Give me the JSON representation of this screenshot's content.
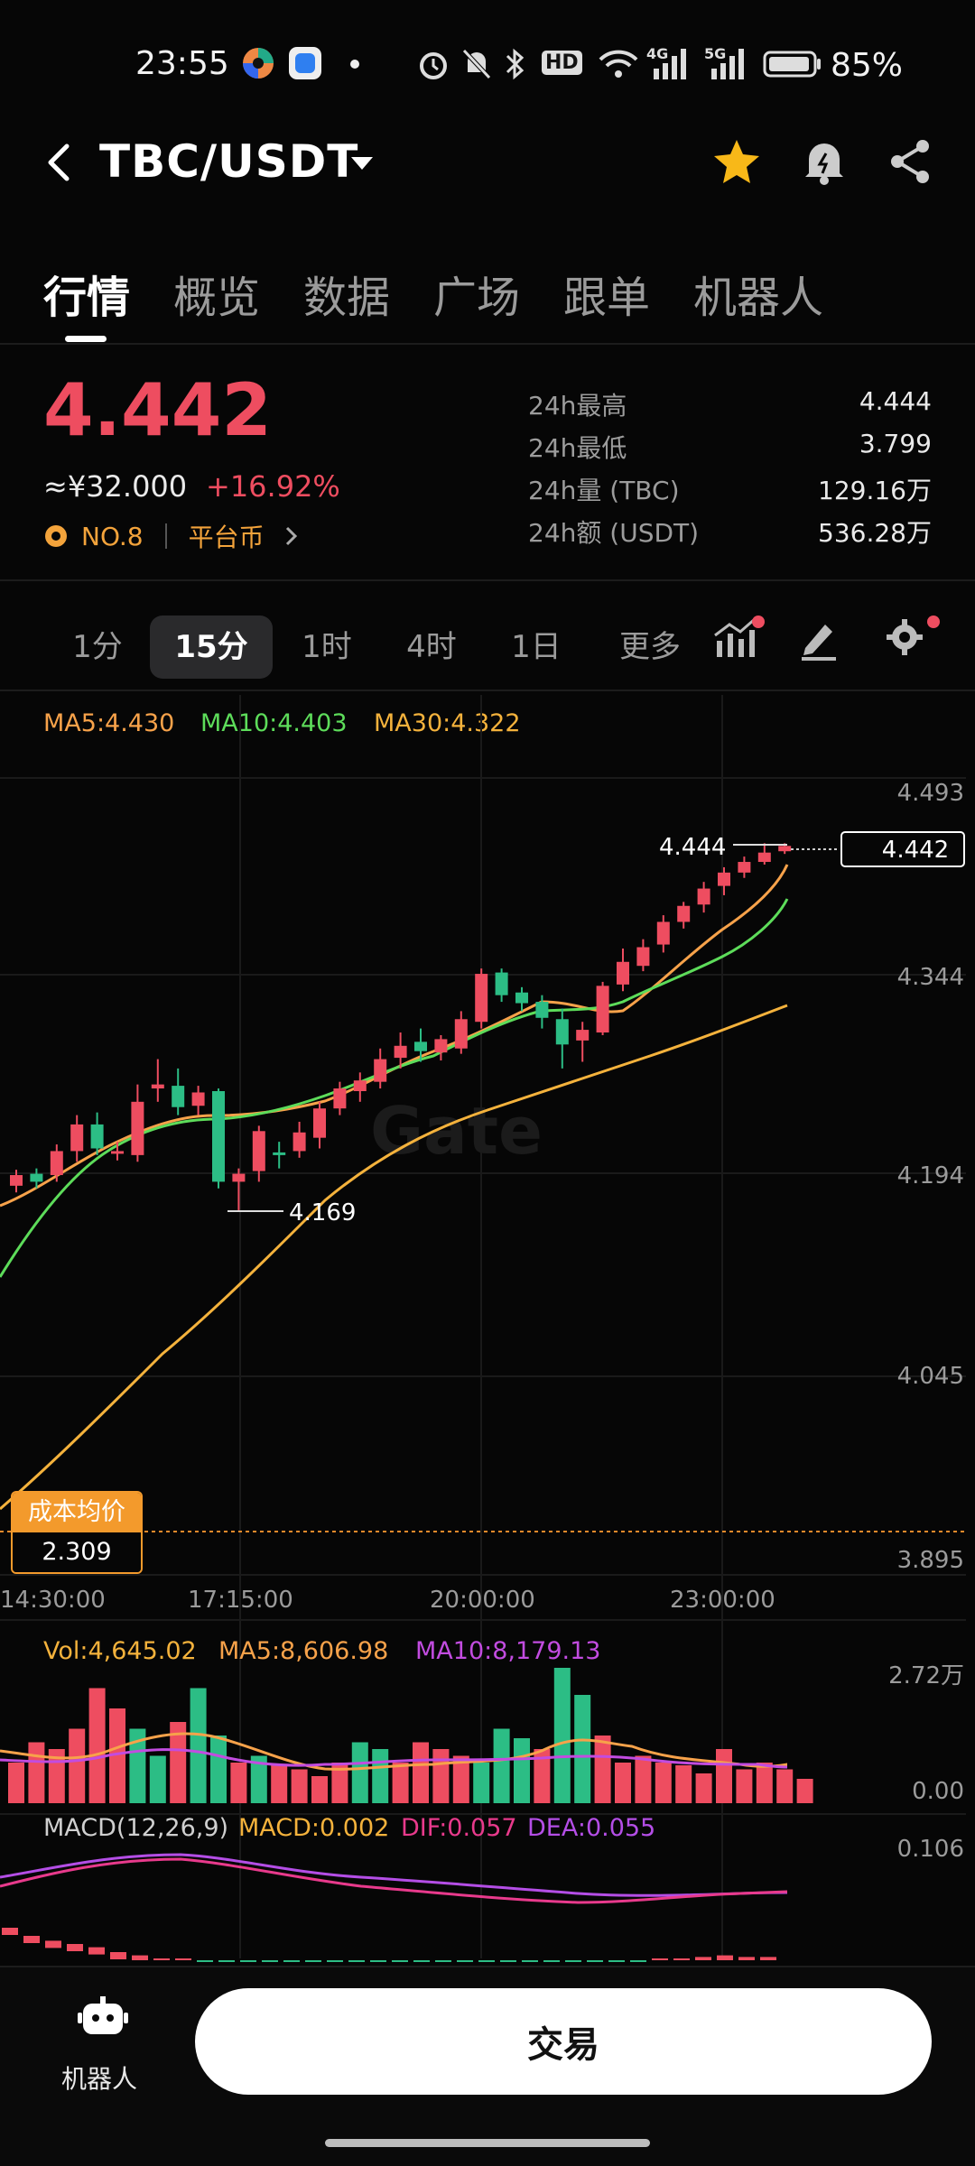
{
  "status_bar": {
    "time": "23:55",
    "battery": "85%",
    "hd": "HD",
    "net4g": "4G",
    "net5g": "5G"
  },
  "header": {
    "pair": "TBC/USDT"
  },
  "tabs": [
    "行情",
    "概览",
    "数据",
    "广场",
    "跟单",
    "机器人"
  ],
  "ticker": {
    "price": "4.442",
    "cny": "≈¥32.000",
    "change": "+16.92%",
    "rank": "NO.8",
    "platform": "平台币",
    "stats": [
      {
        "label": "24h最高",
        "value": "4.444"
      },
      {
        "label": "24h最低",
        "value": "3.799"
      },
      {
        "label": "24h量 (TBC)",
        "value": "129.16万"
      },
      {
        "label": "24h额 (USDT)",
        "value": "536.28万"
      }
    ]
  },
  "intervals": {
    "items": [
      "1分",
      "15分",
      "1时",
      "4时",
      "1日",
      "更多"
    ],
    "active": "15分"
  },
  "colors": {
    "up": "#ee4d60",
    "down": "#2cbd85",
    "ma5": "#f7a24a",
    "ma10": "#5ddc5a",
    "ma30": "#f4b23c",
    "vol_ma10": "#c24ce0",
    "dif": "#e83a8c",
    "dea": "#b44ee6"
  },
  "main_chart": {
    "ma_legend": {
      "ma5": "MA5:4.430",
      "ma10": "MA10:4.403",
      "ma30": "MA30:4.322"
    },
    "y_labels": [
      "4.493",
      "4.344",
      "4.194",
      "4.045",
      "3.895"
    ],
    "x_labels": [
      "14:30:00",
      "17:15:00",
      "20:00:00",
      "23:00:00"
    ],
    "high_marker": "4.444",
    "low_marker": "4.169",
    "last_price": "4.442",
    "cost_label": "成本均价",
    "cost_value": "2.309",
    "watermark": "Gate"
  },
  "volume_chart": {
    "legend": {
      "vol": "Vol:4,645.02",
      "ma5": "MA5:8,606.98",
      "ma10": "MA10:8,179.13"
    },
    "y_labels": [
      "2.72万",
      "0.00"
    ]
  },
  "macd_chart": {
    "legend": {
      "title": "MACD(12,26,9)",
      "macd": "MACD:0.002",
      "dif": "DIF:0.057",
      "dea": "DEA:0.055"
    },
    "y_labels": [
      "0.106"
    ]
  },
  "chart_data": {
    "type": "candlestick",
    "ylim": [
      3.895,
      4.493
    ],
    "candles": [
      [
        4.195,
        4.187,
        4.199,
        4.182,
        "up"
      ],
      [
        4.19,
        4.196,
        4.2,
        4.185,
        "down"
      ],
      [
        4.195,
        4.213,
        4.218,
        4.19,
        "up"
      ],
      [
        4.213,
        4.233,
        4.24,
        4.205,
        "up"
      ],
      [
        4.233,
        4.215,
        4.242,
        4.21,
        "down"
      ],
      [
        4.213,
        4.213,
        4.22,
        4.206,
        "up"
      ],
      [
        4.21,
        4.25,
        4.263,
        4.205,
        "up"
      ],
      [
        4.26,
        4.263,
        4.282,
        4.25,
        "up"
      ],
      [
        4.262,
        4.246,
        4.275,
        4.24,
        "down"
      ],
      [
        4.247,
        4.257,
        4.262,
        4.24,
        "up"
      ],
      [
        4.258,
        4.19,
        4.26,
        4.185,
        "down"
      ],
      [
        4.19,
        4.196,
        4.2,
        4.168,
        "up"
      ],
      [
        4.198,
        4.228,
        4.232,
        4.19,
        "up"
      ],
      [
        4.21,
        4.212,
        4.22,
        4.2,
        "down"
      ],
      [
        4.213,
        4.227,
        4.235,
        4.208,
        "up"
      ],
      [
        4.223,
        4.245,
        4.25,
        4.215,
        "up"
      ],
      [
        4.245,
        4.26,
        4.265,
        4.24,
        "up"
      ],
      [
        4.258,
        4.266,
        4.272,
        4.25,
        "up"
      ],
      [
        4.265,
        4.282,
        4.29,
        4.26,
        "up"
      ],
      [
        4.283,
        4.292,
        4.302,
        4.275,
        "up"
      ],
      [
        4.295,
        4.288,
        4.305,
        4.28,
        "down"
      ],
      [
        4.287,
        4.297,
        4.3,
        4.281,
        "up"
      ],
      [
        4.29,
        4.312,
        4.318,
        4.286,
        "up"
      ],
      [
        4.31,
        4.346,
        4.35,
        4.305,
        "up"
      ],
      [
        4.347,
        4.33,
        4.35,
        4.325,
        "down"
      ],
      [
        4.332,
        4.324,
        4.336,
        4.318,
        "down"
      ],
      [
        4.325,
        4.313,
        4.33,
        4.305,
        "down"
      ],
      [
        4.312,
        4.293,
        4.32,
        4.275,
        "down"
      ],
      [
        4.296,
        4.304,
        4.31,
        4.28,
        "up"
      ],
      [
        4.302,
        4.337,
        4.34,
        4.3,
        "up"
      ],
      [
        4.338,
        4.355,
        4.365,
        4.333,
        "up"
      ],
      [
        4.352,
        4.366,
        4.372,
        4.348,
        "up"
      ],
      [
        4.368,
        4.385,
        4.39,
        4.362,
        "up"
      ],
      [
        4.385,
        4.397,
        4.4,
        4.38,
        "up"
      ],
      [
        4.398,
        4.41,
        4.415,
        4.392,
        "up"
      ],
      [
        4.412,
        4.422,
        4.426,
        4.405,
        "up"
      ],
      [
        4.422,
        4.43,
        4.434,
        4.418,
        "up"
      ],
      [
        4.43,
        4.437,
        4.444,
        4.428,
        "up"
      ],
      [
        4.438,
        4.442,
        4.444,
        4.436,
        "up"
      ]
    ],
    "volume": [
      0.3,
      0.45,
      0.4,
      0.55,
      0.85,
      0.7,
      0.55,
      0.35,
      0.6,
      0.85,
      0.5,
      0.3,
      0.35,
      0.28,
      0.25,
      0.2,
      0.3,
      0.45,
      0.4,
      0.3,
      0.45,
      0.4,
      0.35,
      0.3,
      0.55,
      0.48,
      0.4,
      1.0,
      0.8,
      0.5,
      0.3,
      0.35,
      0.3,
      0.28,
      0.22,
      0.4,
      0.25,
      0.3,
      0.25,
      0.18
    ],
    "volume_dir": [
      "up",
      "up",
      "up",
      "up",
      "up",
      "up",
      "down",
      "down",
      "up",
      "down",
      "down",
      "up",
      "down",
      "up",
      "up",
      "up",
      "up",
      "down",
      "down",
      "up",
      "up",
      "up",
      "up",
      "down",
      "down",
      "down",
      "up",
      "down",
      "down",
      "up",
      "up",
      "up",
      "up",
      "up",
      "up",
      "up",
      "up",
      "up",
      "up",
      "up"
    ],
    "macd_hist": [
      0.2,
      0.15,
      0.12,
      0.1,
      0.08,
      0.05,
      0.03,
      0.01,
      0.0,
      -0.01,
      -0.01,
      -0.01,
      -0.01,
      -0.01,
      -0.01,
      -0.01,
      -0.01,
      -0.01,
      -0.01,
      -0.01,
      -0.01,
      -0.01,
      -0.01,
      -0.01,
      -0.01,
      -0.01,
      -0.01,
      -0.01,
      -0.01,
      -0.01,
      0.0,
      0.01,
      0.02,
      0.03,
      0.02,
      0.02
    ]
  }
}
